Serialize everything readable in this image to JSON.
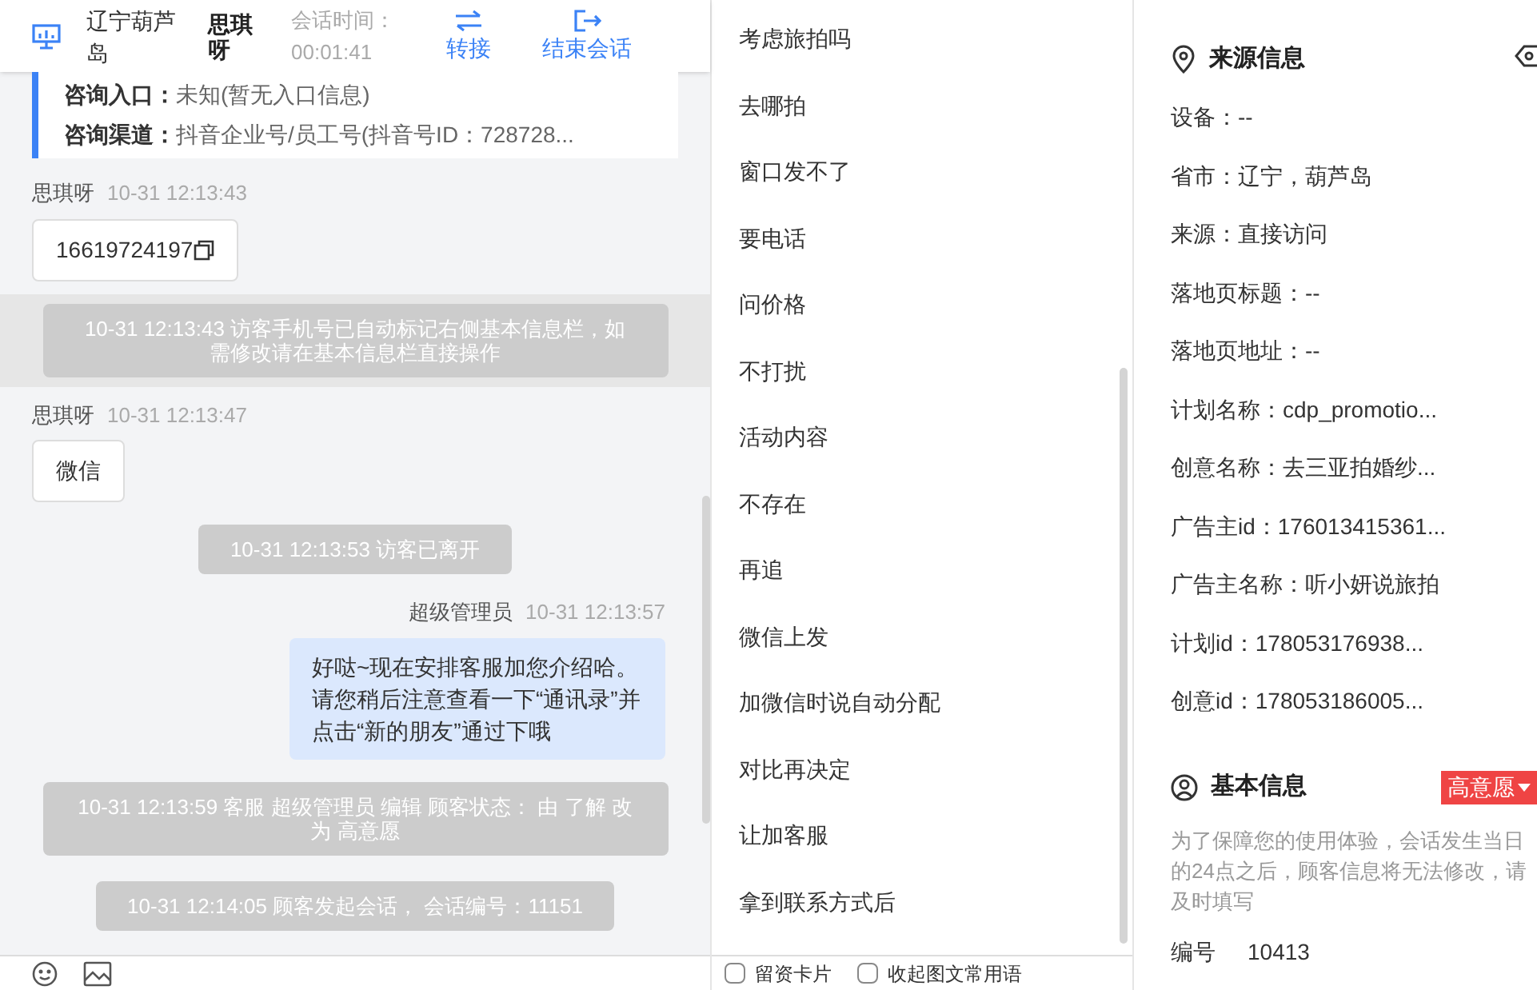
{
  "header": {
    "location": "辽宁葫芦岛",
    "visitor": "思琪呀",
    "session_label": "会话时间：",
    "session_time": "00:01:41",
    "actions": [
      {
        "kind": "transfer",
        "label": "转接"
      },
      {
        "kind": "end",
        "label": "结束会话"
      }
    ]
  },
  "consult": [
    {
      "label": "咨询入口：",
      "value": "未知(暂无入口信息)"
    },
    {
      "label": "咨询渠道：",
      "value": "抖音企业号/员工号(抖音号ID：728728..."
    }
  ],
  "messages": [
    {
      "kind": "visitor",
      "name": "思琪呀",
      "time": "10-31 12:13:43",
      "text": "16619724197",
      "copyable": true
    },
    {
      "kind": "system",
      "text": "10-31 12:13:43 访客手机号已自动标记右侧基本信息栏，如需修改请在基本信息栏直接操作",
      "highlighted": true
    },
    {
      "kind": "visitor",
      "name": "思琪呀",
      "time": "10-31 12:13:47",
      "text": "微信",
      "copyable": false
    },
    {
      "kind": "system",
      "text": "10-31 12:13:53 访客已离开",
      "highlighted": false
    },
    {
      "kind": "agent",
      "name": "超级管理员",
      "time": "10-31 12:13:57",
      "text": "好哒~现在安排客服加您介绍哈。请您稍后注意查看一下“通讯录”并点击“新的朋友”通过下哦"
    },
    {
      "kind": "system",
      "text": "10-31 12:13:59 客服 超级管理员 编辑 顾客状态： 由 了解 改为 高意愿",
      "highlighted": false
    },
    {
      "kind": "system",
      "text": "10-31 12:14:05 顾客发起会话， 会话编号：11151",
      "highlighted": false
    }
  ],
  "phrases": [
    "考虑旅拍吗",
    "去哪拍",
    "窗口发不了",
    "要电话",
    "问价格",
    "不打扰",
    "活动内容",
    "不存在",
    "再追",
    "微信上发",
    "加微信时说自动分配",
    "对比再决定",
    "让加客服",
    "拿到联系方式后"
  ],
  "phrase_options": [
    {
      "label": "留资卡片",
      "checked": false
    },
    {
      "label": "收起图文常用语",
      "checked": false
    }
  ],
  "source": {
    "title": "来源信息",
    "lines": [
      "设备：--",
      "省市：辽宁，葫芦岛",
      "来源：直接访问",
      "落地页标题：--",
      "落地页地址：--",
      "计划名称：cdp_promotio...",
      "创意名称：去三亚拍婚纱...",
      "广告主id：176013415361...",
      "广告主名称：听小妍说旅拍",
      "计划id：178053176938...",
      "创意id：178053186005..."
    ]
  },
  "basic": {
    "title": "基本信息",
    "intent": "高意愿",
    "note": "为了保障您的使用体验，会话发生当日的24点之后，顾客信息将无法修改，请及时填写",
    "id_label": "编号",
    "id_value": "10413"
  }
}
